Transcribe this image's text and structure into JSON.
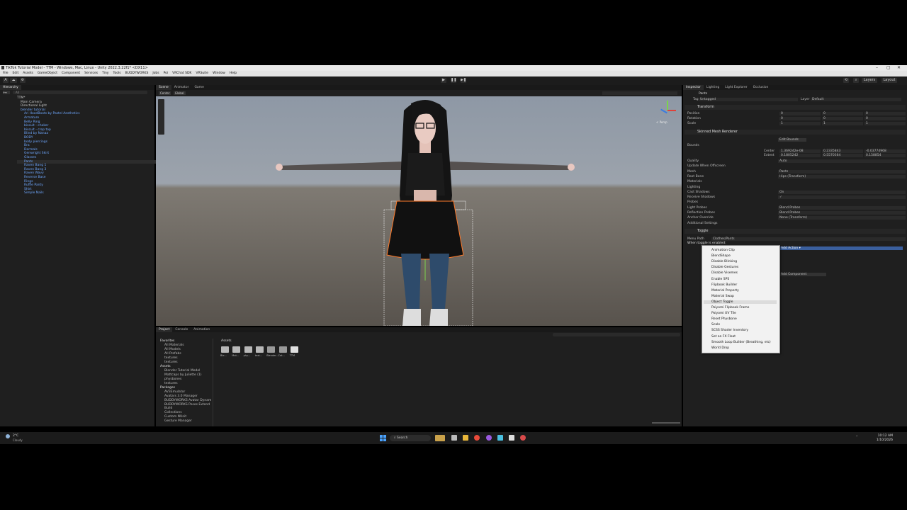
{
  "window": {
    "title": "TikTok Tutorial Model - TTM - Windows, Mac, Linux - Unity 2022.3.22f1* <DX11>",
    "controls": [
      "–",
      "▢",
      "✕"
    ]
  },
  "menu": [
    "File",
    "Edit",
    "Assets",
    "GameObject",
    "Component",
    "Services",
    "Tiny",
    "Tools",
    "BUDDYWORKS",
    "Jobs",
    "Poi",
    "VRChat SDK",
    "VRSuite",
    "Window",
    "Help"
  ],
  "toolbar": {
    "account_label": "A",
    "play_icon": "▶",
    "pause_icon": "❚❚",
    "step_icon": "▶❚",
    "layers_label": "Layers",
    "layout_label": "Layout"
  },
  "hierarchy": {
    "tab": "Hierarchy",
    "search_placeholder": "All",
    "items": [
      {
        "label": "TTM*",
        "indent": 0,
        "blue": false
      },
      {
        "label": "Main Camera",
        "indent": 1,
        "blue": false
      },
      {
        "label": "Directional Light",
        "indent": 1,
        "blue": false
      },
      {
        "label": "blender tutorial",
        "indent": 1,
        "blue": true
      },
      {
        "label": "Ari HoodBoots by Pastel Aesthetics",
        "indent": 2,
        "blue": true
      },
      {
        "label": "Armature",
        "indent": 2,
        "blue": true
      },
      {
        "label": "Belly Ring",
        "indent": 2,
        "blue": true
      },
      {
        "label": "biscuit - choker",
        "indent": 2,
        "blue": true
      },
      {
        "label": "biscuit - crop top",
        "indent": 2,
        "blue": true
      },
      {
        "label": "Blind by Nanaa",
        "indent": 2,
        "blue": true
      },
      {
        "label": "BODY",
        "indent": 2,
        "blue": true
      },
      {
        "label": "body piercings",
        "indent": 2,
        "blue": true
      },
      {
        "label": "Bra",
        "indent": 2,
        "blue": true
      },
      {
        "label": "Dermals",
        "indent": 2,
        "blue": true
      },
      {
        "label": "Genwright Skirt",
        "indent": 2,
        "blue": true
      },
      {
        "label": "Glasses",
        "indent": 2,
        "blue": true
      },
      {
        "label": "Pants",
        "indent": 2,
        "blue": true
      },
      {
        "label": "Raven Bang 1",
        "indent": 2,
        "blue": true
      },
      {
        "label": "Raven Bang 3",
        "indent": 2,
        "blue": true
      },
      {
        "label": "Raven Wavy",
        "indent": 2,
        "blue": true
      },
      {
        "label": "Reverse Base",
        "indent": 2,
        "blue": true
      },
      {
        "label": "Rings",
        "indent": 2,
        "blue": true
      },
      {
        "label": "Ruffle Panty",
        "indent": 2,
        "blue": true
      },
      {
        "label": "Shirt",
        "indent": 2,
        "blue": true
      },
      {
        "label": "Simple Nails",
        "indent": 2,
        "blue": true
      }
    ],
    "selected_index": 16
  },
  "scene": {
    "tabs": [
      "Scene",
      "Animator",
      "Game"
    ],
    "active_tab": 0,
    "view_mode": "Center",
    "space": "Global",
    "persp_label": "< Persp"
  },
  "inspector": {
    "tabs": [
      "Inspector",
      "Lighting",
      "Light Explorer",
      "Occlusion"
    ],
    "object_name": "Pants",
    "tag_label": "Tag",
    "tag_value": "Untagged",
    "layer_label": "Layer",
    "layer_value": "Default",
    "transform": {
      "header": "Transform",
      "rows": [
        {
          "label": "Position",
          "x": "0",
          "y": "0",
          "z": "0"
        },
        {
          "label": "Rotation",
          "x": "0",
          "y": "0",
          "z": "0"
        },
        {
          "label": "Scale",
          "x": "1",
          "y": "1",
          "z": "1"
        }
      ]
    },
    "smr": {
      "header": "Skinned Mesh Renderer",
      "edit_bounds": "Edit Bounds",
      "bounds_label": "Bounds",
      "center_label": "Center",
      "center": [
        "1.369242e-08",
        "0.2335843",
        "-0.03774968"
      ],
      "extent_label": "Extent",
      "extent": [
        "0.1805242",
        "0.5570364",
        "0.158854"
      ],
      "rows": [
        {
          "label": "Quality",
          "value": "Auto"
        },
        {
          "label": "Update When Offscreen",
          "value": ""
        },
        {
          "label": "Mesh",
          "value": "Pants"
        },
        {
          "label": "Root Bone",
          "value": "Hips (Transform)"
        },
        {
          "label": "Materials",
          "value": ""
        },
        {
          "label": "Lighting",
          "value": ""
        },
        {
          "label": "Cast Shadows",
          "value": "On"
        },
        {
          "label": "Receive Shadows",
          "value": "✓"
        },
        {
          "label": "Probes",
          "value": ""
        },
        {
          "label": "Light Probes",
          "value": "Blend Probes"
        },
        {
          "label": "Reflection Probes",
          "value": "Blend Probes"
        },
        {
          "label": "Anchor Override",
          "value": "None (Transform)"
        },
        {
          "label": "Additional Settings",
          "value": ""
        }
      ]
    },
    "toggle": {
      "header": "Toggle",
      "menu_path_label": "Menu Path",
      "menu_path_value": "Clothes/Pants",
      "when_enabled": "When toggle is enabled:",
      "add_action": "Add Action ▾",
      "add_component": "Add Component"
    }
  },
  "dropdown": {
    "items": [
      "Animation Clip",
      "BlendShape",
      "Disable Blinking",
      "Disable Gestures",
      "Disable Visemes",
      "Enable SPS",
      "Flipbook Builder",
      "Material Property",
      "Material Swap",
      "Object Toggle",
      "Poiyomi Flipbook Frame",
      "Poiyomi UV Tile",
      "Reset Physbone",
      "Scale",
      "SCSS Shader Inventory",
      "Set an FX Float",
      "Smooth Loop Builder (Breathing, etc)",
      "World Drop"
    ],
    "hovered_index": 9
  },
  "project": {
    "tabs": [
      "Project",
      "Console",
      "Animation"
    ],
    "favorites_label": "Favorites",
    "favorites": [
      "All Materials",
      "All Models",
      "All Prefabs",
      "textures",
      "textures"
    ],
    "assets_label": "Assets",
    "assets_tree": [
      "Blender Tutorial Model",
      "Mattcaps by Juliette (1)",
      "physbones",
      "textures"
    ],
    "packages_label": "Packages",
    "packages": [
      "AV3Emulator",
      "Avatars 3.0 Manager",
      "BUDDYWORKS Avatar Dynam",
      "BUDDYWORKS Poses Extend",
      "Build",
      "Collections",
      "Custom NUnit",
      "Gesture Manager"
    ],
    "breadcrumb": "Assets",
    "grid": [
      "Ble...",
      "Mat...",
      "phy...",
      "text...",
      "Blender...",
      "Cat...",
      "TTM"
    ]
  },
  "taskbar": {
    "weather_temp": "2°C",
    "weather_text": "Cloudy",
    "search_label": "Search",
    "time": "10:12 AM",
    "date": "1/10/2026"
  }
}
